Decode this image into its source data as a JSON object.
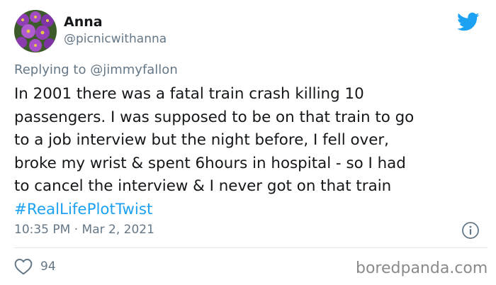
{
  "author": {
    "display_name": "Anna",
    "handle": "@picnicwithanna"
  },
  "reply": {
    "prefix": "Replying to",
    "mention": "@jimmyfallon"
  },
  "body": {
    "lines": [
      "In 2001 there was a fatal train crash killing 10",
      "passengers. I was supposed to be on that train to go",
      "to a job interview but the night before, I fell over,",
      "broke my wrist & spent 6hours in hospital - so I had",
      "to cancel the interview & I never got on that train"
    ],
    "hashtag": "#RealLifePlotTwist"
  },
  "meta": {
    "timestamp": "10:35 PM · Mar 2, 2021"
  },
  "engagement": {
    "likes": "94"
  },
  "watermark": "boredpanda.com",
  "colors": {
    "twitter_blue": "#1da1f2",
    "text": "#14171a",
    "muted": "#657786",
    "divider": "#e1e8ed"
  },
  "icons": {
    "brand": "twitter-bird-icon",
    "info": "info-icon",
    "like": "heart-icon"
  }
}
